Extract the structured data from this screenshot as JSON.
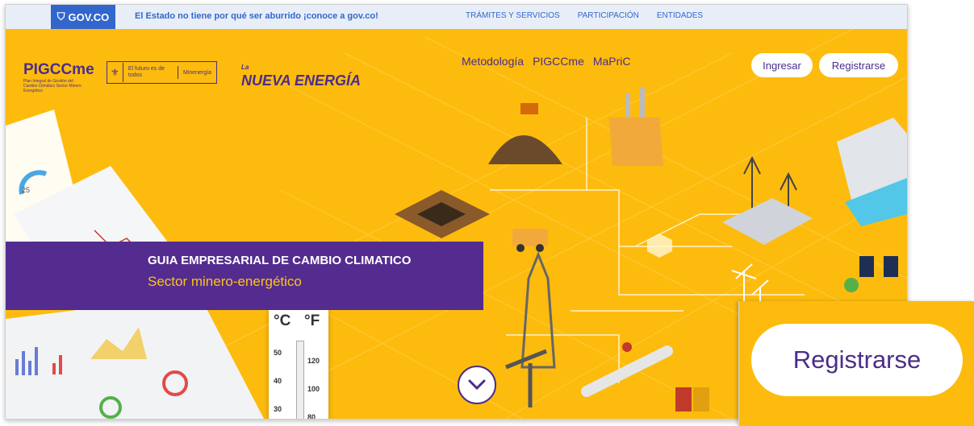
{
  "gov_bar": {
    "logo": "GOV.CO",
    "message": "El Estado no tiene por qué ser aburrido ¡conoce a gov.co!",
    "links": [
      "TRÁMITES Y SERVICIOS",
      "PARTICIPACIÓN",
      "ENTIDADES"
    ]
  },
  "header": {
    "logo_pig": "PIGCCme",
    "logo_pig_sub": "Plan Integral de Gestión del Cambio Climático Sector Minero Energético",
    "logo_gob_a": "El futuro es de todos",
    "logo_gob_b": "Minenergía",
    "logo_ne_small": "La",
    "logo_ne": "NUEVA ENERGÍA",
    "nav": [
      "Metodología",
      "PIGCCme",
      "MaPriC"
    ],
    "login_label": "Ingresar",
    "register_label": "Registrarse"
  },
  "hero": {
    "title": "GUIA EMPRESARIAL DE CAMBIO CLIMATICO",
    "subtitle": "Sector minero-energético",
    "thermometer": {
      "c_label": "°C",
      "f_label": "°F",
      "c_ticks": [
        "50",
        "40",
        "30"
      ],
      "f_ticks": [
        "120",
        "100",
        "80"
      ]
    },
    "chart_label": "25"
  },
  "zoom": {
    "register_label": "Registrarse"
  },
  "colors": {
    "hero_bg": "#fdbb0e",
    "brand_purple": "#542c8f",
    "gov_blue": "#3366cc",
    "subtitle_yellow": "#fdc31a"
  }
}
